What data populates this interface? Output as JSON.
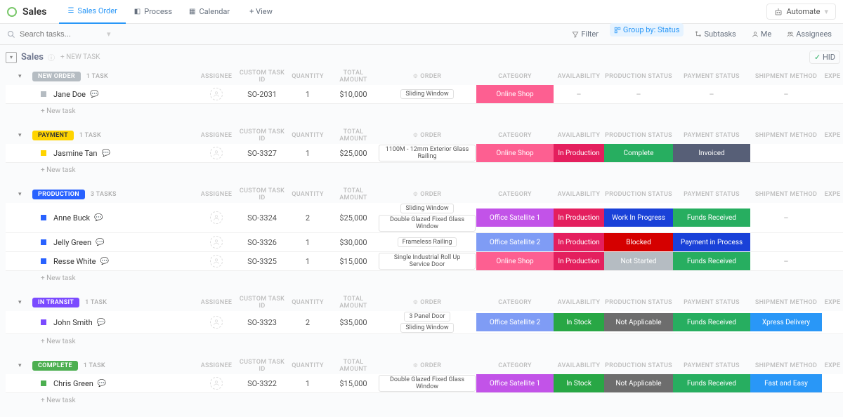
{
  "header": {
    "title": "Sales",
    "tabs": [
      {
        "label": "Sales Order",
        "active": true
      },
      {
        "label": "Process",
        "active": false
      },
      {
        "label": "Calendar",
        "active": false
      }
    ],
    "add_view": "+ View",
    "automate": "Automate"
  },
  "toolbar": {
    "search_placeholder": "Search tasks...",
    "filter": "Filter",
    "group_by": "Group by: Status",
    "subtasks": "Subtasks",
    "me": "Me",
    "assignees": "Assignees",
    "hide": "HID"
  },
  "list": {
    "name": "Sales",
    "new_task_top": "+ NEW TASK"
  },
  "columns": {
    "assignee": "ASSIGNEE",
    "custom_id": "CUSTOM TASK ID",
    "qty": "QUANTITY",
    "total": "TOTAL AMOUNT",
    "order": "ORDER",
    "category": "CATEGORY",
    "availability": "AVAILABILITY",
    "prod_status": "PRODUCTION STATUS",
    "pay_status": "PAYMENT STATUS",
    "ship_method": "SHIPMENT METHOD",
    "expe": "EXPE"
  },
  "new_task_row": "+ New task",
  "groups": [
    {
      "status": "NEW ORDER",
      "pill_class": "p-neworder",
      "sq_class": "sq-grey",
      "count": "1 TASK",
      "rows": [
        {
          "name": "Jane Doe",
          "id": "SO-2031",
          "qty": "1",
          "total": "$10,000",
          "orders": [
            "Sliding Window"
          ],
          "cat": {
            "t": "Online Shop",
            "c": "b-onlineshop"
          },
          "avail": {
            "t": "–",
            "c": "dash"
          },
          "prod": {
            "t": "–",
            "c": "dash"
          },
          "pay": {
            "t": "–",
            "c": "dash"
          },
          "ship": {
            "t": "–",
            "c": "dash"
          }
        }
      ]
    },
    {
      "status": "PAYMENT",
      "pill_class": "p-payment",
      "sq_class": "sq-yellow",
      "count": "1 TASK",
      "rows": [
        {
          "name": "Jasmine Tan",
          "id": "SO-3327",
          "qty": "1",
          "total": "$25,000",
          "orders": [
            "1100M - 12mm Exterior Glass Railing"
          ],
          "cat": {
            "t": "Online Shop",
            "c": "b-onlineshop"
          },
          "avail": {
            "t": "In Production",
            "c": "b-inprod"
          },
          "prod": {
            "t": "Complete",
            "c": "b-complete"
          },
          "pay": {
            "t": "Invoiced",
            "c": "b-invoiced"
          },
          "ship": {
            "t": "",
            "c": ""
          }
        }
      ]
    },
    {
      "status": "PRODUCTION",
      "pill_class": "p-production",
      "sq_class": "sq-blue",
      "count": "3 TASKS",
      "rows": [
        {
          "name": "Anne Buck",
          "id": "SO-3324",
          "qty": "2",
          "total": "$25,000",
          "orders": [
            "Sliding Window",
            "Double Glazed Fixed Glass Window"
          ],
          "cat": {
            "t": "Office Satellite 1",
            "c": "b-cat-sat1"
          },
          "avail": {
            "t": "In Production",
            "c": "b-inprod"
          },
          "prod": {
            "t": "Work In Progress",
            "c": "b-wip"
          },
          "pay": {
            "t": "Funds Received",
            "c": "b-funds"
          },
          "ship": {
            "t": "–",
            "c": "dash"
          }
        },
        {
          "name": "Jelly Green",
          "id": "SO-3326",
          "qty": "1",
          "total": "$30,000",
          "orders": [
            "Frameless Railing"
          ],
          "cat": {
            "t": "Office Satellite 2",
            "c": "b-cat-sat2"
          },
          "avail": {
            "t": "In Production",
            "c": "b-inprod"
          },
          "prod": {
            "t": "Blocked",
            "c": "b-blocked"
          },
          "pay": {
            "t": "Payment in Process",
            "c": "b-payproc"
          },
          "ship": {
            "t": "",
            "c": ""
          }
        },
        {
          "name": "Resse White",
          "id": "SO-3325",
          "qty": "1",
          "total": "$15,000",
          "orders": [
            "Single Industrial Roll Up Service Door"
          ],
          "cat": {
            "t": "Online Shop",
            "c": "b-onlineshop"
          },
          "avail": {
            "t": "In Production",
            "c": "b-inprod"
          },
          "prod": {
            "t": "Not Started",
            "c": "b-notstarted"
          },
          "pay": {
            "t": "Funds Received",
            "c": "b-funds"
          },
          "ship": {
            "t": "–",
            "c": "dash"
          }
        }
      ]
    },
    {
      "status": "IN TRANSIT",
      "pill_class": "p-intransit",
      "sq_class": "sq-purple",
      "count": "1 TASK",
      "rows": [
        {
          "name": "John Smith",
          "id": "SO-3323",
          "qty": "2",
          "total": "$35,000",
          "orders": [
            "3 Panel Door",
            "Sliding Window"
          ],
          "cat": {
            "t": "Office Satellite 2",
            "c": "b-cat-sat2"
          },
          "avail": {
            "t": "In Stock",
            "c": "b-instock"
          },
          "prod": {
            "t": "Not Applicable",
            "c": "b-notappl"
          },
          "pay": {
            "t": "Funds Received",
            "c": "b-funds"
          },
          "ship": {
            "t": "Xpress Delivery",
            "c": "b-xpress"
          }
        }
      ]
    },
    {
      "status": "COMPLETE",
      "pill_class": "p-complete",
      "sq_class": "sq-green",
      "count": "1 TASK",
      "rows": [
        {
          "name": "Chris Green",
          "id": "SO-3322",
          "qty": "1",
          "total": "$15,000",
          "orders": [
            "Double Glazed Fixed Glass Window"
          ],
          "cat": {
            "t": "Office Satellite 1",
            "c": "b-cat-sat1"
          },
          "avail": {
            "t": "In Stock",
            "c": "b-instock"
          },
          "prod": {
            "t": "Not Applicable",
            "c": "b-notappl"
          },
          "pay": {
            "t": "Funds Received",
            "c": "b-funds"
          },
          "ship": {
            "t": "Fast and Easy",
            "c": "b-fast"
          }
        }
      ]
    }
  ]
}
